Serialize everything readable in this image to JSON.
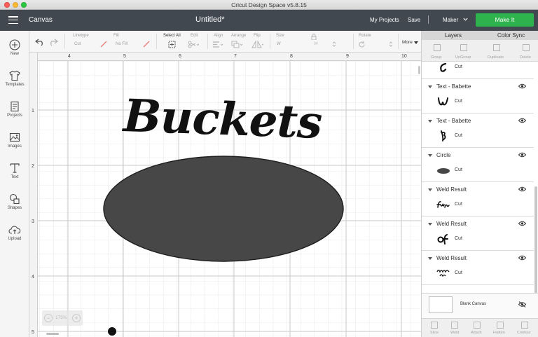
{
  "window": {
    "title": "Cricut Design Space  v5.8.15"
  },
  "header": {
    "section": "Canvas",
    "document": "Untitled*",
    "my_projects": "My Projects",
    "save": "Save",
    "separator": "|",
    "machine": "Maker",
    "make_it": "Make It",
    "colors": {
      "bar": "#414850",
      "make_it": "#2eb24e"
    }
  },
  "toolbar": {
    "linetype_label": "Linetype",
    "linetype_value": "Cut",
    "fill_label": "Fill",
    "fill_value": "No Fill",
    "select_all": "Select All",
    "edit": "Edit",
    "align": "Align",
    "arrange": "Arrange",
    "flip": "Flip",
    "size": "Size",
    "size_w": "W",
    "size_h": "H",
    "rotate": "Rotate",
    "more": "More"
  },
  "sidebar": {
    "items": [
      {
        "label": "New",
        "icon": "plus-circle-icon"
      },
      {
        "label": "Templates",
        "icon": "shirt-icon"
      },
      {
        "label": "Projects",
        "icon": "projects-icon"
      },
      {
        "label": "Images",
        "icon": "image-icon"
      },
      {
        "label": "Text",
        "icon": "text-icon"
      },
      {
        "label": "Shapes",
        "icon": "shapes-icon"
      },
      {
        "label": "Upload",
        "icon": "cloud-upload-icon"
      }
    ]
  },
  "rulers": {
    "top": [
      "4",
      "5",
      "6",
      "7",
      "8",
      "9",
      "10"
    ],
    "left": [
      "1",
      "2",
      "3",
      "4",
      "5"
    ]
  },
  "canvas": {
    "text": "Buckets",
    "zoom": "175%",
    "ellipse_color": "#474747"
  },
  "panel": {
    "tabs": [
      "Layers",
      "Color Sync"
    ],
    "group_actions": [
      "Group",
      "UnGroup",
      "Duplicate",
      "Delete"
    ],
    "layers": [
      {
        "name": "",
        "operation": "Cut",
        "glyph": "c"
      },
      {
        "name": "Text - Babette",
        "operation": "Cut",
        "glyph": "w"
      },
      {
        "name": "Text - Babette",
        "operation": "Cut",
        "glyph": "b"
      },
      {
        "name": "Circle",
        "operation": "Cut",
        "glyph": "ellipse"
      },
      {
        "name": "Weld Result",
        "operation": "Cut",
        "glyph": "fun"
      },
      {
        "name": "Weld Result",
        "operation": "Cut",
        "glyph": "of"
      },
      {
        "name": "Weld Result",
        "operation": "Cut",
        "glyph": "buckets-fun"
      }
    ],
    "blank_canvas": "Blank Canvas",
    "bottom_actions": [
      "Slice",
      "Weld",
      "Attach",
      "Flatten",
      "Contour"
    ]
  }
}
